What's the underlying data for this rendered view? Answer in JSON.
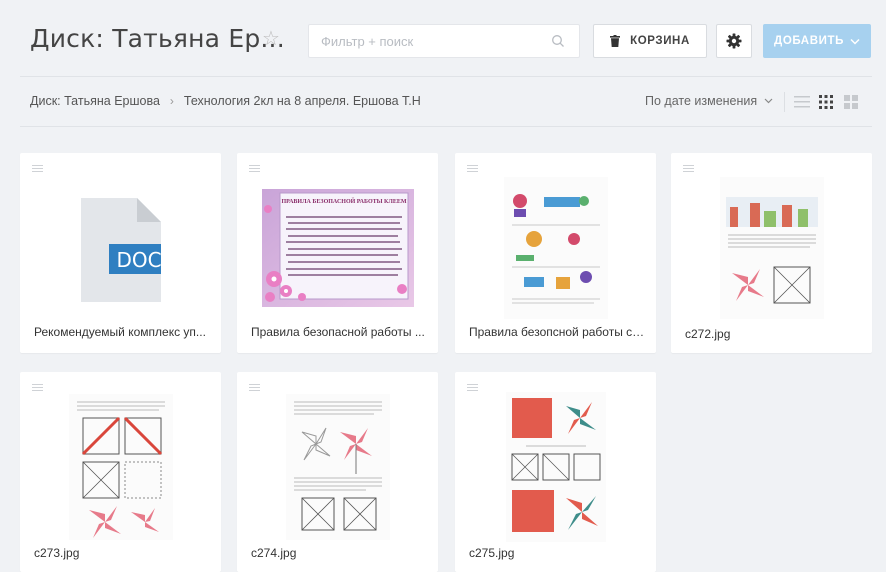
{
  "header": {
    "title": "Диск: Татьяна Ер...",
    "search_placeholder": "Фильтр + поиск",
    "trash_label": "КОРЗИНА",
    "add_label": "ДОБАВИТЬ"
  },
  "breadcrumb": {
    "root": "Диск: Татьяна Ершова",
    "current": "Технология 2кл на 8 апреля. Ершова Т.Н"
  },
  "sort": {
    "label": "По дате изменения"
  },
  "doc_badge": "DOC",
  "rules_doc": {
    "title": "ПРАВИЛА БЕЗОПАСНОЙ РАБОТЫ КЛЕЕМ"
  },
  "files": [
    {
      "name": "Рекомендуемый комплекс уп..."
    },
    {
      "name": "Правила безопасной работы ..."
    },
    {
      "name": "Правила безопсной работы с ..."
    },
    {
      "name": "c272.jpg"
    },
    {
      "name": "c273.jpg"
    },
    {
      "name": "c274.jpg"
    },
    {
      "name": "c275.jpg"
    }
  ],
  "colors": {
    "accent": "#a7d1ef",
    "doc_blue": "#2f7fc1",
    "background": "#f0f2f5"
  }
}
